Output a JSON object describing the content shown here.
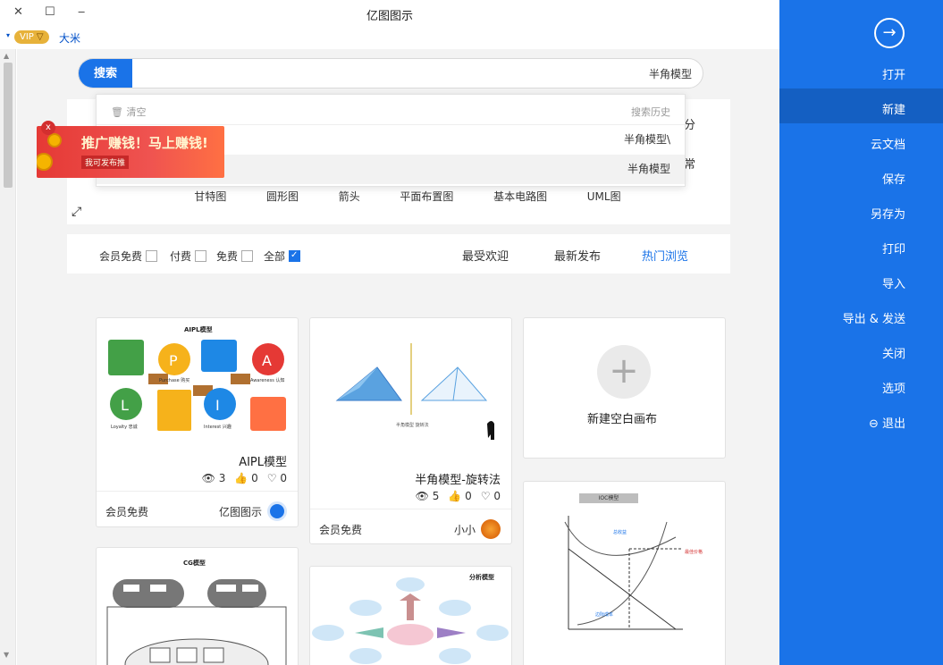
{
  "window": {
    "title": "亿图图示",
    "close_glyph": "✕",
    "max_glyph": "☐",
    "min_glyph": "‒"
  },
  "user": {
    "caret": "▾",
    "vip": "VIP",
    "name": "大米"
  },
  "search": {
    "button": "搜索",
    "value": "半角模型"
  },
  "search_dropdown": {
    "title": "搜索历史",
    "clear": "清空",
    "items": [
      "半角模型\\",
      "半角模型"
    ]
  },
  "category_panel": {
    "side_labels": [
      "分",
      "常"
    ],
    "row": [
      "UML图",
      "基本电路图",
      "平面布置图",
      "箭头",
      "圆形图",
      "甘特图"
    ]
  },
  "ad": {
    "headline": "推广赚钱！马上赚钱!",
    "sub": "我可发布推"
  },
  "filters": {
    "tabs": [
      "热门浏览",
      "最新发布",
      "最受欢迎"
    ],
    "checks": [
      "全部",
      "免费",
      "付费",
      "会员免费"
    ]
  },
  "cards": [
    {
      "kind": "new",
      "title": "新建空白画布"
    },
    {
      "kind": "template",
      "title": "半角模型-旋转法",
      "views": "5",
      "likes": "0",
      "favorites": "0",
      "author": "小小",
      "badge": "会员免费"
    },
    {
      "kind": "template",
      "title": "AIPL模型",
      "views": "3",
      "likes": "0",
      "favorites": "0",
      "author": "亿图图示",
      "badge": "会员免费"
    },
    {
      "kind": "preview",
      "title": "CG模型"
    },
    {
      "kind": "preview",
      "title": "分析模型"
    },
    {
      "kind": "preview",
      "title": "IOC模型"
    }
  ],
  "aipl": {
    "header": "AIPL模型",
    "letters": [
      "A",
      "I",
      "P",
      "L"
    ],
    "sublabels": [
      "Awareness 认知",
      "Interest 兴趣",
      "Purchase 购买",
      "Loyalty 忠诚"
    ],
    "colors": [
      "#e53935",
      "#1e88e5",
      "#f6b21b",
      "#43a047"
    ]
  },
  "sidebar": {
    "items": [
      "打开",
      "新建",
      "云文档",
      "保存",
      "另存为",
      "打印",
      "导入",
      "导出 & 发送",
      "关闭",
      "选项",
      "退出"
    ]
  },
  "icons": {
    "back": "arrow-right-circle-icon",
    "expand": "expand-arrows-icon",
    "trash": "trash-icon",
    "eye": "eye-icon",
    "thumb": "thumb-up-icon",
    "heart": "heart-icon"
  },
  "colors": {
    "accent": "#1a73e8",
    "sidebar_active": "#145fc2",
    "vip": "#e7b23a"
  }
}
